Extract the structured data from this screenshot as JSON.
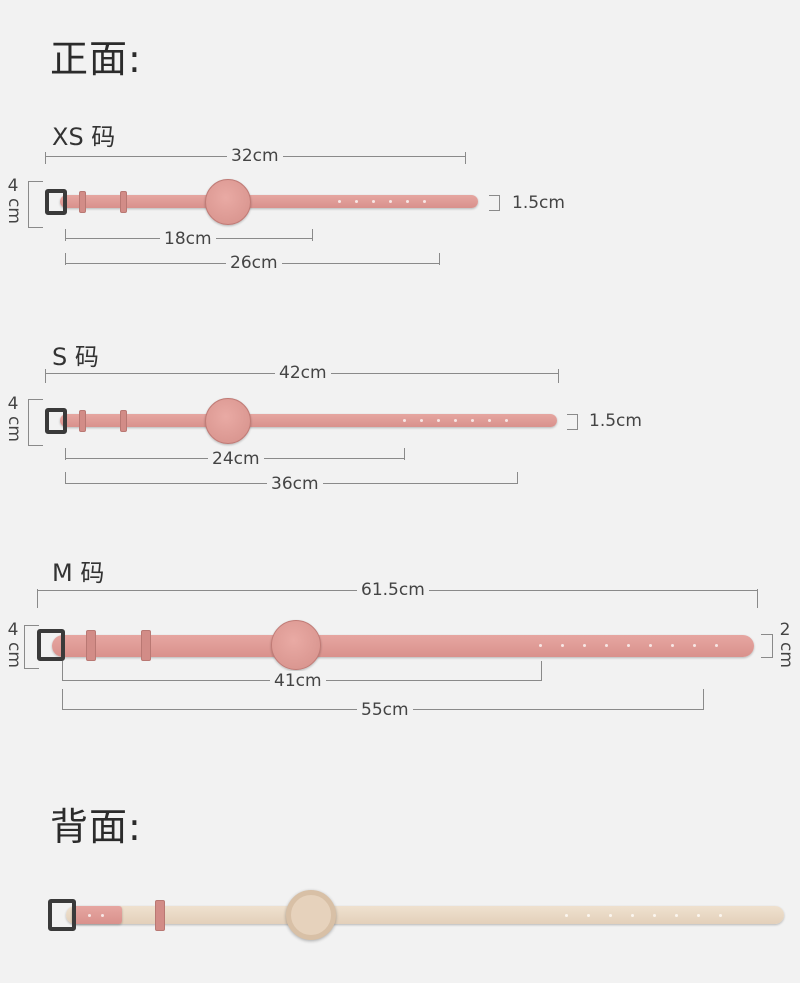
{
  "front_heading": "正面:",
  "back_heading": "背面:",
  "sizes": {
    "xs": {
      "label": "XS 码",
      "total": "32cm",
      "width": "1.5cm",
      "height": "4",
      "height_unit": "cm",
      "inner": "18cm",
      "mid": "26cm"
    },
    "s": {
      "label": "S 码",
      "total": "42cm",
      "width": "1.5cm",
      "height": "4",
      "height_unit": "cm",
      "inner": "24cm",
      "mid": "36cm"
    },
    "m": {
      "label": "M 码",
      "total": "61.5cm",
      "width": "2",
      "width_unit": "cm",
      "height": "4",
      "height_unit": "cm",
      "inner": "41cm",
      "mid": "55cm"
    }
  },
  "colors": {
    "front_strap": "#df9c97",
    "back_strap": "#ead9c5",
    "buckle": "#3a3a3a"
  }
}
